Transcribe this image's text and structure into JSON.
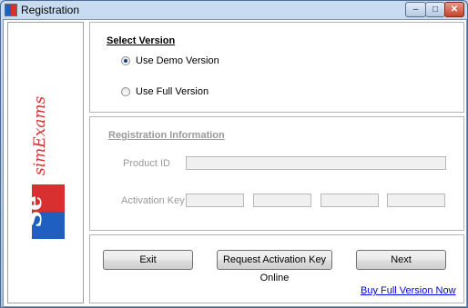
{
  "window": {
    "title": "Registration",
    "minimize_glyph": "–",
    "maximize_glyph": "□",
    "close_glyph": "✕"
  },
  "brand": {
    "logo_text": "simExams",
    "logo_icon": "se-logo-icon",
    "colors": {
      "red": "#d83030",
      "blue": "#1f5fc2"
    }
  },
  "version": {
    "heading": "Select Version",
    "options": [
      {
        "label": "Use Demo Version",
        "selected": true
      },
      {
        "label": "Use Full Version",
        "selected": false
      }
    ]
  },
  "registration": {
    "heading": "Registration Information",
    "product_id_label": "Product ID",
    "product_id_value": "",
    "activation_key_label": "Activation Key",
    "activation_key_parts": [
      "",
      "",
      "",
      ""
    ]
  },
  "actions": {
    "exit_label": "Exit",
    "request_label": "Request Activation Key Online",
    "next_label": "Next",
    "buy_link": "Buy Full Version Now"
  }
}
